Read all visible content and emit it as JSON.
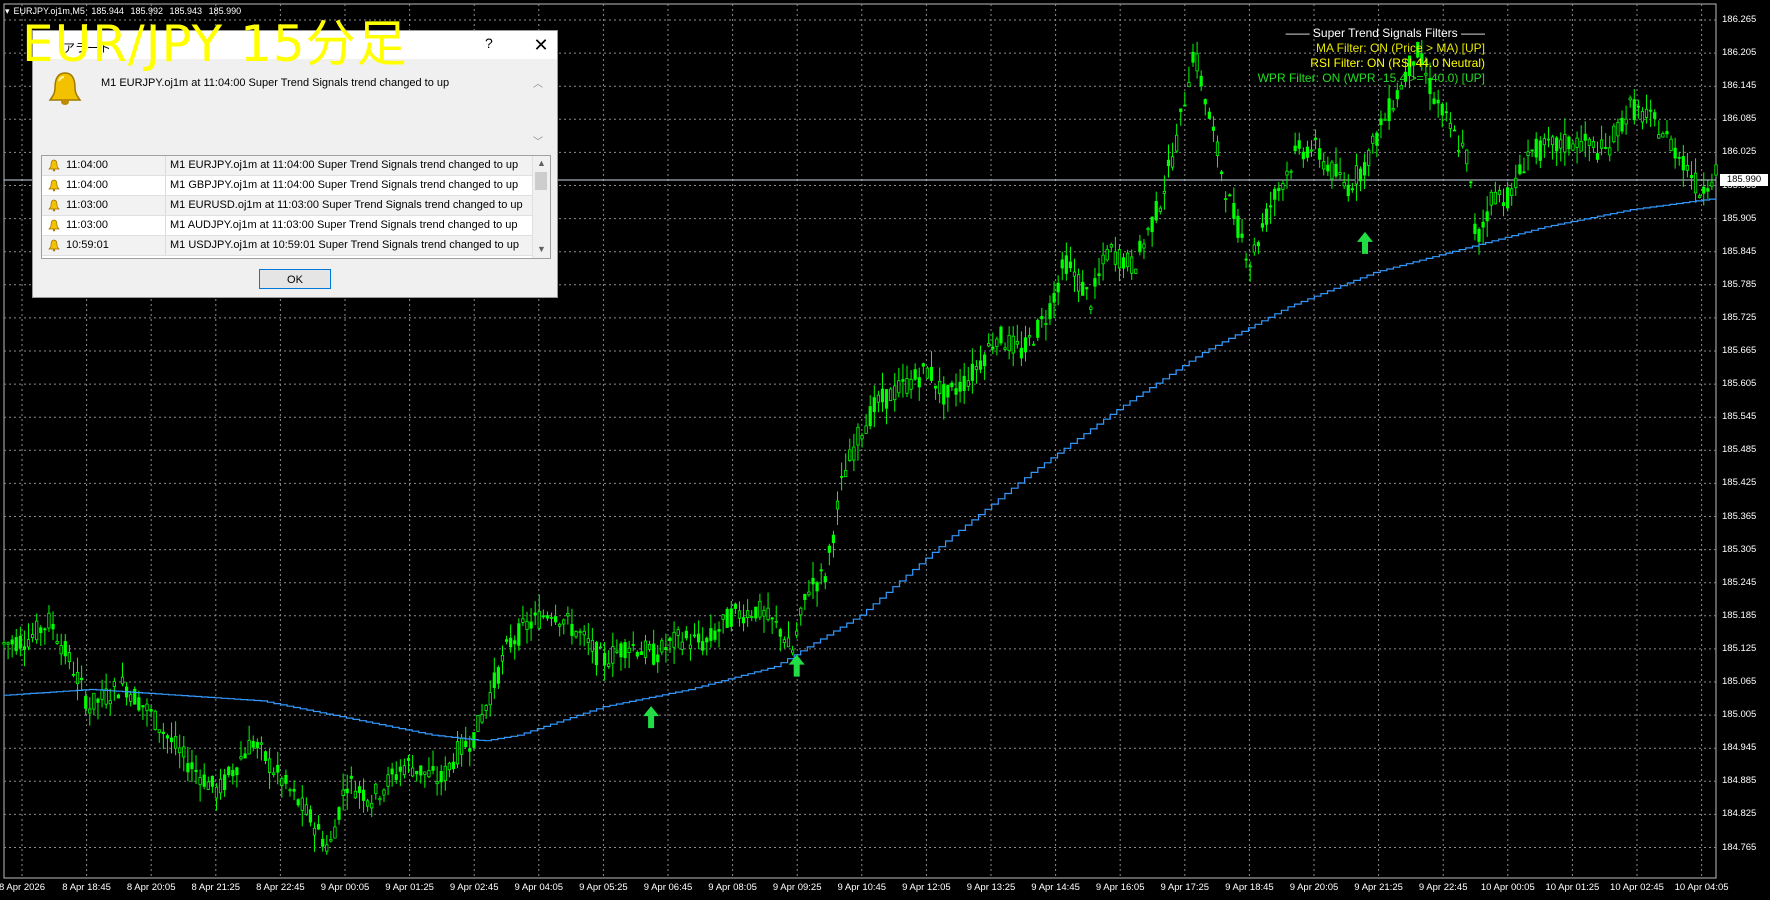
{
  "overlay": {
    "title": "EUR/JPY 15分足"
  },
  "symbol_header": {
    "symbol": "EURJPY.oj1m,M5",
    "open": "185.944",
    "high": "185.992",
    "low": "185.943",
    "close": "185.990"
  },
  "filters_panel": {
    "heading": "—— Super Trend Signals Filters ——",
    "lines": [
      {
        "text": "MA Filter: ON (Price > MA) [UP]",
        "color": "#e6e600"
      },
      {
        "text": "RSI Filter: ON (RSI 44.0 Neutral)",
        "color": "#ffff00"
      },
      {
        "text": "WPR Filter: ON (WPR -15.4 >= -40.0) [UP]",
        "color": "#22dd22"
      }
    ]
  },
  "alert_dialog": {
    "title": "アラート",
    "help": "?",
    "close": "✕",
    "message": "M1 EURJPY.oj1m at 11:04:00 Super Trend Signals trend changed to up",
    "rows": [
      {
        "time": "11:04:00",
        "message": "M1 EURJPY.oj1m at 11:04:00 Super Trend Signals trend changed to up"
      },
      {
        "time": "11:04:00",
        "message": "M1 GBPJPY.oj1m at 11:04:00 Super Trend Signals trend changed to up"
      },
      {
        "time": "11:03:00",
        "message": "M1 EURUSD.oj1m at 11:03:00 Super Trend Signals trend changed to up"
      },
      {
        "time": "11:03:00",
        "message": "M1 AUDJPY.oj1m at 11:03:00 Super Trend Signals trend changed to up"
      },
      {
        "time": "10:59:01",
        "message": "M1 USDJPY.oj1m at 10:59:01 Super Trend Signals trend changed to up"
      }
    ],
    "ok_label": "OK"
  },
  "price_axis": [
    "186.265",
    "186.205",
    "186.145",
    "186.085",
    "186.025",
    "185.965",
    "185.905",
    "185.845",
    "185.785",
    "185.725",
    "185.665",
    "185.605",
    "185.545",
    "185.485",
    "185.425",
    "185.365",
    "185.305",
    "185.245",
    "185.185",
    "185.125",
    "185.065",
    "185.005",
    "184.945",
    "184.885",
    "184.825",
    "184.765"
  ],
  "current_price": "185.990",
  "time_axis": [
    "8 Apr 2026",
    "8 Apr 18:45",
    "8 Apr 20:05",
    "8 Apr 21:25",
    "8 Apr 22:45",
    "9 Apr 00:05",
    "9 Apr 01:25",
    "9 Apr 02:45",
    "9 Apr 04:05",
    "9 Apr 05:25",
    "9 Apr 06:45",
    "9 Apr 08:05",
    "9 Apr 09:25",
    "9 Apr 10:45",
    "9 Apr 12:05",
    "9 Apr 13:25",
    "9 Apr 14:45",
    "9 Apr 16:05",
    "9 Apr 17:25",
    "9 Apr 18:45",
    "9 Apr 20:05",
    "9 Apr 21:25",
    "9 Apr 22:45",
    "10 Apr 00:05",
    "10 Apr 01:25",
    "10 Apr 02:45",
    "10 Apr 04:05"
  ],
  "chart_data": {
    "type": "line",
    "price_range": [
      184.75,
      186.28
    ],
    "candle_color": "#00ff00",
    "trend_line_color": "#3399ff",
    "arrow_color": "#22dd44",
    "price_path": [
      {
        "t": 0.0,
        "p": 185.16
      },
      {
        "t": 0.015,
        "p": 185.17
      },
      {
        "t": 0.027,
        "p": 185.2
      },
      {
        "t": 0.04,
        "p": 185.12
      },
      {
        "t": 0.05,
        "p": 185.05
      },
      {
        "t": 0.07,
        "p": 185.09
      },
      {
        "t": 0.085,
        "p": 185.04
      },
      {
        "t": 0.105,
        "p": 184.96
      },
      {
        "t": 0.125,
        "p": 184.9
      },
      {
        "t": 0.145,
        "p": 184.99
      },
      {
        "t": 0.16,
        "p": 184.93
      },
      {
        "t": 0.18,
        "p": 184.85
      },
      {
        "t": 0.19,
        "p": 184.8
      },
      {
        "t": 0.2,
        "p": 184.92
      },
      {
        "t": 0.215,
        "p": 184.89
      },
      {
        "t": 0.235,
        "p": 184.95
      },
      {
        "t": 0.255,
        "p": 184.92
      },
      {
        "t": 0.265,
        "p": 184.97
      },
      {
        "t": 0.275,
        "p": 185.0
      },
      {
        "t": 0.285,
        "p": 185.08
      },
      {
        "t": 0.295,
        "p": 185.16
      },
      {
        "t": 0.305,
        "p": 185.19
      },
      {
        "t": 0.32,
        "p": 185.22
      },
      {
        "t": 0.335,
        "p": 185.18
      },
      {
        "t": 0.35,
        "p": 185.13
      },
      {
        "t": 0.365,
        "p": 185.16
      },
      {
        "t": 0.38,
        "p": 185.14
      },
      {
        "t": 0.395,
        "p": 185.17
      },
      {
        "t": 0.41,
        "p": 185.16
      },
      {
        "t": 0.425,
        "p": 185.21
      },
      {
        "t": 0.44,
        "p": 185.22
      },
      {
        "t": 0.455,
        "p": 185.18
      },
      {
        "t": 0.46,
        "p": 185.14
      },
      {
        "t": 0.47,
        "p": 185.26
      },
      {
        "t": 0.48,
        "p": 185.28
      },
      {
        "t": 0.49,
        "p": 185.45
      },
      {
        "t": 0.5,
        "p": 185.53
      },
      {
        "t": 0.51,
        "p": 185.58
      },
      {
        "t": 0.525,
        "p": 185.61
      },
      {
        "t": 0.54,
        "p": 185.64
      },
      {
        "t": 0.55,
        "p": 185.59
      },
      {
        "t": 0.565,
        "p": 185.63
      },
      {
        "t": 0.58,
        "p": 185.7
      },
      {
        "t": 0.595,
        "p": 185.67
      },
      {
        "t": 0.61,
        "p": 185.74
      },
      {
        "t": 0.62,
        "p": 185.83
      },
      {
        "t": 0.635,
        "p": 185.76
      },
      {
        "t": 0.645,
        "p": 185.85
      },
      {
        "t": 0.66,
        "p": 185.82
      },
      {
        "t": 0.675,
        "p": 185.93
      },
      {
        "t": 0.685,
        "p": 186.04
      },
      {
        "t": 0.695,
        "p": 186.2
      },
      {
        "t": 0.705,
        "p": 186.07
      },
      {
        "t": 0.715,
        "p": 185.94
      },
      {
        "t": 0.728,
        "p": 185.83
      },
      {
        "t": 0.74,
        "p": 185.93
      },
      {
        "t": 0.755,
        "p": 186.02
      },
      {
        "t": 0.765,
        "p": 186.03
      },
      {
        "t": 0.775,
        "p": 185.99
      },
      {
        "t": 0.785,
        "p": 185.96
      },
      {
        "t": 0.795,
        "p": 186.0
      },
      {
        "t": 0.805,
        "p": 186.07
      },
      {
        "t": 0.815,
        "p": 186.13
      },
      {
        "t": 0.825,
        "p": 186.2
      },
      {
        "t": 0.835,
        "p": 186.12
      },
      {
        "t": 0.845,
        "p": 186.06
      },
      {
        "t": 0.855,
        "p": 186.01
      },
      {
        "t": 0.86,
        "p": 185.86
      },
      {
        "t": 0.87,
        "p": 185.95
      },
      {
        "t": 0.88,
        "p": 185.94
      },
      {
        "t": 0.89,
        "p": 186.02
      },
      {
        "t": 0.905,
        "p": 186.03
      },
      {
        "t": 0.92,
        "p": 186.04
      },
      {
        "t": 0.935,
        "p": 186.02
      },
      {
        "t": 0.95,
        "p": 186.1
      },
      {
        "t": 0.965,
        "p": 186.07
      },
      {
        "t": 0.975,
        "p": 186.03
      },
      {
        "t": 0.985,
        "p": 185.99
      },
      {
        "t": 0.99,
        "p": 185.95
      },
      {
        "t": 1.0,
        "p": 185.99
      }
    ],
    "trend_path": [
      {
        "t": 0.0,
        "p": 185.07
      },
      {
        "t": 0.05,
        "p": 185.08
      },
      {
        "t": 0.1,
        "p": 185.07
      },
      {
        "t": 0.15,
        "p": 185.06
      },
      {
        "t": 0.2,
        "p": 185.03
      },
      {
        "t": 0.25,
        "p": 185.0
      },
      {
        "t": 0.28,
        "p": 184.99
      },
      {
        "t": 0.3,
        "p": 185.0
      },
      {
        "t": 0.35,
        "p": 185.05
      },
      {
        "t": 0.4,
        "p": 185.08
      },
      {
        "t": 0.45,
        "p": 185.12
      },
      {
        "t": 0.5,
        "p": 185.21
      },
      {
        "t": 0.55,
        "p": 185.34
      },
      {
        "t": 0.6,
        "p": 185.46
      },
      {
        "t": 0.65,
        "p": 185.57
      },
      {
        "t": 0.7,
        "p": 185.67
      },
      {
        "t": 0.75,
        "p": 185.75
      },
      {
        "t": 0.8,
        "p": 185.81
      },
      {
        "t": 0.85,
        "p": 185.85
      },
      {
        "t": 0.9,
        "p": 185.89
      },
      {
        "t": 0.95,
        "p": 185.92
      },
      {
        "t": 1.0,
        "p": 185.94
      }
    ],
    "arrows": [
      {
        "t": 0.378,
        "p": 185.03
      },
      {
        "t": 0.463,
        "p": 185.12
      },
      {
        "t": 0.795,
        "p": 185.86
      }
    ]
  }
}
